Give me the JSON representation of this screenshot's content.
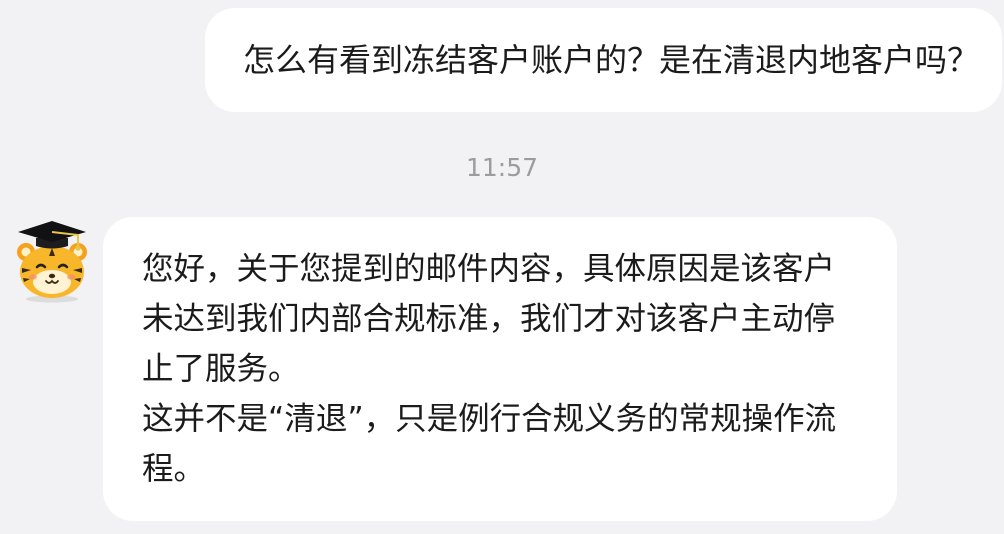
{
  "chat": {
    "outgoing": {
      "text": "怎么有看到冻结客户账户的？是在清退内地客户吗？"
    },
    "timestamp": "11:57",
    "incoming": {
      "avatar_icon": "tiger-graduate-avatar-icon",
      "lines": [
        "您好，关于您提到的邮件内容，具体原因是该客户",
        "未达到我们内部合规标准，我们才对该客户主动停",
        "止了服务。",
        "这并不是“清退”，只是例行合规义务的常规操作流",
        "程。"
      ]
    }
  },
  "colors": {
    "background": "#f2f2f4",
    "bubble": "#ffffff",
    "text": "#1b1b1b",
    "timestamp": "#9c9c9c",
    "avatar_fur": "#f8b62b"
  }
}
